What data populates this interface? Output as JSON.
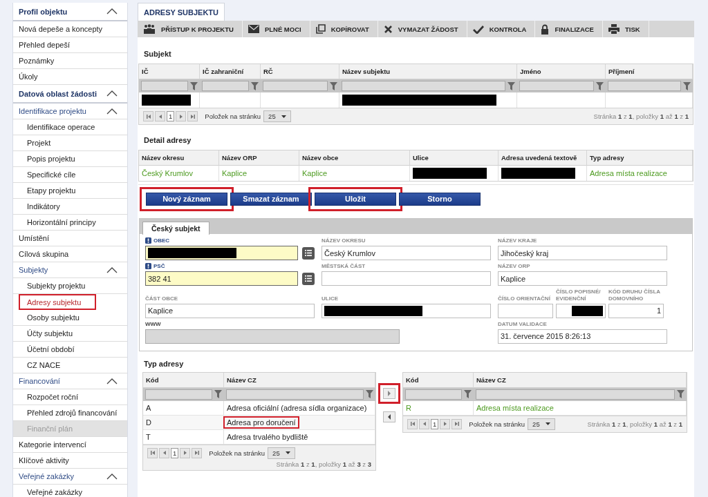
{
  "sidebar": {
    "items": [
      {
        "label": "Profil objektu",
        "kind": "section",
        "expanded": true,
        "selected": false,
        "children": [
          {
            "label": "Nová depeše a koncepty",
            "kind": "item",
            "selected": false
          },
          {
            "label": "Přehled depeší",
            "kind": "item",
            "selected": false
          },
          {
            "label": "Poznámky",
            "kind": "item",
            "selected": false
          },
          {
            "label": "Úkoly",
            "kind": "item",
            "selected": false
          }
        ]
      },
      {
        "label": "Datová oblast žádosti",
        "kind": "section",
        "expanded": true,
        "selected": false,
        "children": [
          {
            "label": "Identifikace projektu",
            "kind": "group",
            "expanded": true,
            "selected": false,
            "children": [
              {
                "label": "Identifikace operace",
                "kind": "item",
                "selected": false
              },
              {
                "label": "Projekt",
                "kind": "item",
                "selected": false
              },
              {
                "label": "Popis projektu",
                "kind": "item",
                "selected": false
              },
              {
                "label": "Specifické cíle",
                "kind": "item",
                "selected": false
              },
              {
                "label": "Etapy projektu",
                "kind": "item",
                "selected": false
              },
              {
                "label": "Indikátory",
                "kind": "item",
                "selected": false
              },
              {
                "label": "Horizontální principy",
                "kind": "item",
                "selected": false
              }
            ]
          },
          {
            "label": "Umístění",
            "kind": "item",
            "selected": false
          },
          {
            "label": "Cílová skupina",
            "kind": "item",
            "selected": false
          },
          {
            "label": "Subjekty",
            "kind": "group",
            "expanded": true,
            "selected": false,
            "children": [
              {
                "label": "Subjekty projektu",
                "kind": "item",
                "selected": false
              },
              {
                "label": "Adresy subjektu",
                "kind": "item",
                "selected": true,
                "highlighted": true
              },
              {
                "label": "Osoby subjektu",
                "kind": "item",
                "selected": false
              },
              {
                "label": "Účty subjektu",
                "kind": "item",
                "selected": false
              },
              {
                "label": "Účetní období",
                "kind": "item",
                "selected": false
              },
              {
                "label": "CZ NACE",
                "kind": "item",
                "selected": false
              }
            ]
          },
          {
            "label": "Financování",
            "kind": "group",
            "expanded": true,
            "selected": false,
            "children": [
              {
                "label": "Rozpočet roční",
                "kind": "item",
                "selected": false
              },
              {
                "label": "Přehled zdrojů financování",
                "kind": "item",
                "selected": false
              },
              {
                "label": "Finanční plán",
                "kind": "item",
                "selected": false,
                "disabled": true
              }
            ]
          },
          {
            "label": "Kategorie intervencí",
            "kind": "item",
            "selected": false
          },
          {
            "label": "Klíčové aktivity",
            "kind": "item",
            "selected": false
          },
          {
            "label": "Veřejné zakázky",
            "kind": "group",
            "expanded": true,
            "selected": false,
            "children": [
              {
                "label": "Veřejné zakázky",
                "kind": "item",
                "selected": false
              }
            ]
          }
        ]
      }
    ]
  },
  "page_tab": "ADRESY SUBJEKTU",
  "toolbar": [
    {
      "label": "PŘÍSTUP K PROJEKTU"
    },
    {
      "label": "PLNÉ MOCI"
    },
    {
      "label": "KOPÍROVAT"
    },
    {
      "label": "VYMAZAT ŽÁDOST"
    },
    {
      "label": "KONTROLA"
    },
    {
      "label": "FINALIZACE"
    },
    {
      "label": "TISK"
    }
  ],
  "subject": {
    "title": "Subjekt",
    "columns": [
      "IČ",
      "IČ zahraniční",
      "RČ",
      "Název subjektu",
      "Jméno",
      "Příjmení"
    ],
    "rows": [
      [
        {
          "redacted": true
        },
        {},
        {},
        {
          "redacted": true
        },
        {},
        {}
      ]
    ],
    "pager": {
      "page": "1",
      "per_page_label": "Položek na stránku",
      "per_page": "25",
      "info": "Stránka **1** z **1**, položky **1** až **1** z **1**"
    }
  },
  "address_detail": {
    "title": "Detail adresy",
    "columns": [
      "Název okresu",
      "Název ORP",
      "Název obce",
      "Ulice",
      "Adresa uvedená textově",
      "Typ adresy"
    ],
    "rows": [
      [
        {
          "text": "Český Krumlov"
        },
        {
          "text": "Kaplice"
        },
        {
          "text": "Kaplice"
        },
        {
          "redacted": true
        },
        {
          "redacted": true
        },
        {
          "text": "Adresa místa realizace"
        }
      ]
    ]
  },
  "buttons": [
    {
      "label": "Nový záznam",
      "highlighted": true
    },
    {
      "label": "Smazat záznam",
      "highlighted": false
    },
    {
      "label": "Uložit",
      "highlighted": true
    },
    {
      "label": "Storno",
      "highlighted": false
    }
  ],
  "form": {
    "tab": "Český subjekt",
    "rows": [
      {
        "fields": [
          {
            "label": "OBEC",
            "kind": "lookup",
            "required": true,
            "redacted": true
          },
          {
            "label": "NÁZEV OKRESU",
            "kind": "text",
            "value": "Český Krumlov"
          },
          {
            "label": "NÁZEV KRAJE",
            "kind": "text",
            "value": "Jihočeský kraj"
          }
        ]
      },
      {
        "fields": [
          {
            "label": "PSČ",
            "kind": "lookup",
            "required": true,
            "value": "382 41"
          },
          {
            "label": "MĚSTSKÁ ČÁST",
            "kind": "text"
          },
          {
            "label": "NÁZEV ORP",
            "kind": "text",
            "value": "Kaplice"
          }
        ]
      },
      {
        "fields": [
          {
            "label": "ČÁST OBCE",
            "kind": "text",
            "value": "Kaplice"
          },
          {
            "label": "ULICE",
            "kind": "text",
            "redacted": true
          },
          {
            "label": "ČÍSLO ORIENTAČNÍ",
            "kind": "small"
          },
          {
            "label": "ČÍSLO POPISNÉ/ EVIDENČNÍ",
            "kind": "small",
            "redacted": true
          },
          {
            "label": "KÓD DRUHU ČÍSLA DOMOVNÍHO",
            "kind": "small",
            "value": "1"
          }
        ]
      },
      {
        "fields": [
          {
            "label": "WWW",
            "kind": "wide",
            "disabled": true
          },
          {
            "label": "DATUM VALIDACE",
            "kind": "text",
            "value": "31. července 2015 8:26:13"
          }
        ]
      }
    ]
  },
  "address_type": {
    "title": "Typ adresy",
    "available": {
      "columns": [
        "Kód",
        "Název CZ"
      ],
      "rows": [
        {
          "code": "A",
          "name": "Adresa oficiální (adresa sídla organizace)",
          "highlighted": false
        },
        {
          "code": "D",
          "name": "Adresa pro doručení",
          "highlighted": true
        },
        {
          "code": "T",
          "name": "Adresa trvalého bydliště",
          "highlighted": false
        }
      ],
      "pager": {
        "page": "1",
        "per_page_label": "Položek na stránku",
        "per_page": "25",
        "info": "Stránka **1** z **1**, položky **1** až **3** z **3**"
      }
    },
    "move_buttons": [
      {
        "kind": "right",
        "highlighted": true
      },
      {
        "kind": "left",
        "highlighted": false
      }
    ],
    "assigned": {
      "columns": [
        "Kód",
        "Název CZ"
      ],
      "rows": [
        {
          "code": "R",
          "name": "Adresa místa realizace",
          "highlighted": false
        }
      ],
      "pager": {
        "page": "1",
        "per_page_label": "Položek na stránku",
        "per_page": "25",
        "info": "Stránka **1** z **1**, položky **1** až **1** z **1**"
      }
    }
  }
}
